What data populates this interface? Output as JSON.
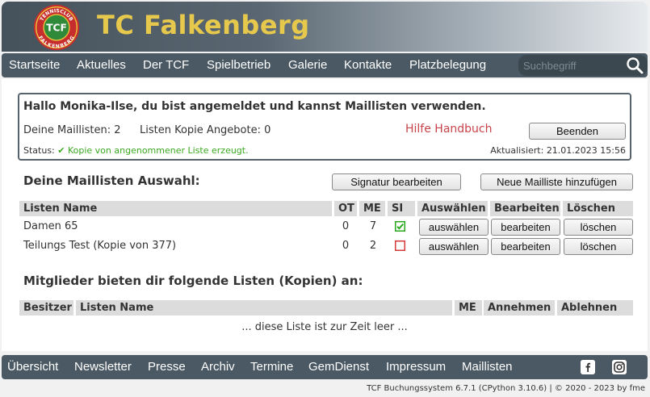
{
  "header": {
    "title": "TC Falkenberg",
    "logo": {
      "top_text": "TENNISCLUB",
      "center_text": "TCF",
      "bottom_text": "FALKENBERG"
    }
  },
  "topnav": {
    "items": [
      "Startseite",
      "Aktuelles",
      "Der TCF",
      "Spielbetrieb",
      "Galerie",
      "Kontakte",
      "Platzbelegung"
    ],
    "search_placeholder": "Suchbegriff"
  },
  "info": {
    "greeting": "Hallo Monika-Ilse, du bist angemeldet und kannst Maillisten verwenden.",
    "my_lists": "Deine Maillisten: 2",
    "copy_offers": "Listen Kopie Angebote: 0",
    "help_link": "Hilfe Handbuch",
    "end_button": "Beenden",
    "status_label": "Status: ",
    "status_message": "✔ Kopie von angenommener Liste erzeugt.",
    "updated": "Aktualisiert: 21.01.2023 15:56"
  },
  "my_lists": {
    "title": "Deine Maillisten Auswahl:",
    "signature_button": "Signatur bearbeiten",
    "new_list_button": "Neue Mailliste hinzufügen",
    "columns": {
      "name": "Listen Name",
      "ot": "OT",
      "me": "ME",
      "si": "SI",
      "select": "Auswählen",
      "edit": "Bearbeiten",
      "delete": "Löschen"
    },
    "rows": [
      {
        "name": "Damen 65",
        "ot": "0",
        "me": "7",
        "si": true,
        "select": "auswählen",
        "edit": "bearbeiten",
        "delete": "löschen"
      },
      {
        "name": "Teilungs Test (Kopie von 377)",
        "ot": "0",
        "me": "2",
        "si": false,
        "select": "auswählen",
        "edit": "bearbeiten",
        "delete": "löschen"
      }
    ],
    "colors": {
      "si_checked": "#2aa81e",
      "si_unchecked": "#d63b3b"
    }
  },
  "offers": {
    "title": "Mitglieder bieten dir folgende Listen (Kopien) an:",
    "columns": {
      "owner": "Besitzer",
      "name": "Listen Name",
      "me": "ME",
      "accept": "Annehmen",
      "reject": "Ablehnen"
    },
    "empty": "... diese Liste ist zur Zeit leer ..."
  },
  "footnav": {
    "items": [
      "Übersicht",
      "Newsletter",
      "Presse",
      "Archiv",
      "Termine",
      "GemDienst",
      "Impressum",
      "Maillisten"
    ],
    "social": [
      "facebook-icon",
      "instagram-icon"
    ]
  },
  "footer": {
    "copyright": "TCF Buchungssystem 6.7.1 (CPython 3.10.6)  |  © 2020 - 2023 by fme"
  }
}
